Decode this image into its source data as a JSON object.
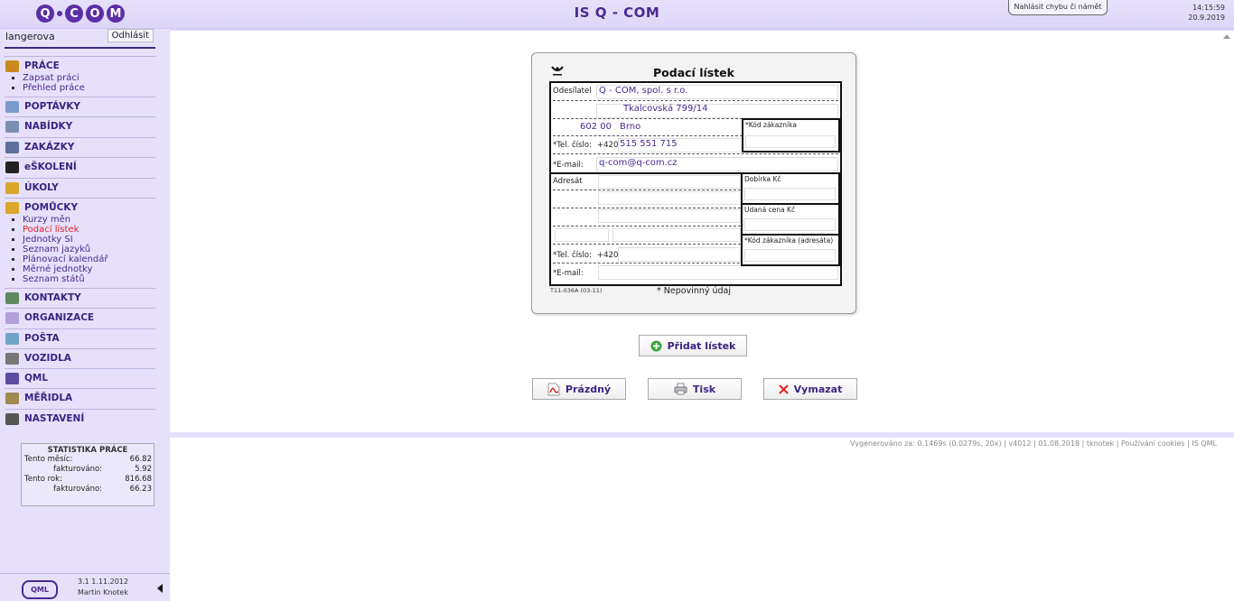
{
  "header": {
    "logo_letters": [
      "Q",
      "C",
      "O",
      "M"
    ],
    "title": "IS Q - COM",
    "bug_button": "Nahlásit chybu či námět",
    "time": "14:15:59",
    "date": "20.9.2019"
  },
  "user": {
    "name": "langerova",
    "logout_label": "Odhlásit"
  },
  "nav": [
    {
      "key": "prace",
      "label": "PRÁCE",
      "icon": "briefcase-icon",
      "color": "#c98a1f",
      "subitems": [
        {
          "label": "Zapsat práci",
          "active": false
        },
        {
          "label": "Přehled práce",
          "active": false
        }
      ]
    },
    {
      "key": "poptavky",
      "label": "POPTÁVKY",
      "icon": "bulb-icon",
      "color": "#7a9acb",
      "subitems": []
    },
    {
      "key": "nabidky",
      "label": "NABÍDKY",
      "icon": "document-icon",
      "color": "#7a8fb0",
      "subitems": []
    },
    {
      "key": "zakazky",
      "label": "ZAKÁZKY",
      "icon": "toolbox-icon",
      "color": "#5a6f9a",
      "subitems": []
    },
    {
      "key": "eskoleni",
      "label": "eŠKOLENÍ",
      "icon": "graduation-cap-icon",
      "color": "#222222",
      "subitems": []
    },
    {
      "key": "ukoly",
      "label": "ÚKOLY",
      "icon": "checklist-icon",
      "color": "#d9a72a",
      "subitems": []
    },
    {
      "key": "pomucky",
      "label": "POMŮCKY",
      "icon": "coins-icon",
      "color": "#d9a72a",
      "subitems": [
        {
          "label": "Kurzy měn",
          "active": false
        },
        {
          "label": "Podací lístek",
          "active": true
        },
        {
          "label": "Jednotky SI",
          "active": false
        },
        {
          "label": "Seznam jazyků",
          "active": false
        },
        {
          "label": "Plánovací kalendář",
          "active": false
        },
        {
          "label": "Měrné jednotky",
          "active": false
        },
        {
          "label": "Seznam států",
          "active": false
        }
      ]
    },
    {
      "key": "kontakty",
      "label": "KONTAKTY",
      "icon": "contacts-icon",
      "color": "#5f8a5f",
      "subitems": []
    },
    {
      "key": "organizace",
      "label": "ORGANIZACE",
      "icon": "cube-icon",
      "color": "#b3a0d8",
      "subitems": []
    },
    {
      "key": "posta",
      "label": "POŠTA",
      "icon": "mail-icon",
      "color": "#6fa3c8",
      "subitems": []
    },
    {
      "key": "vozidla",
      "label": "VOZIDLA",
      "icon": "car-icon",
      "color": "#777777",
      "subitems": []
    },
    {
      "key": "qml",
      "label": "QML",
      "icon": "qml-icon",
      "color": "#5a4aa0",
      "subitems": []
    },
    {
      "key": "meridla",
      "label": "MĚŘIDLA",
      "icon": "ruler-icon",
      "color": "#a08a50",
      "subitems": []
    },
    {
      "key": "nastaveni",
      "label": "NASTAVENÍ",
      "icon": "tools-icon",
      "color": "#555555",
      "subitems": []
    }
  ],
  "stats": {
    "title": "STATISTIKA PRÁCE",
    "rows": [
      {
        "label": "Tento měsíc:",
        "value": "66.82",
        "indent": false
      },
      {
        "label": "fakturováno:",
        "value": "5.92",
        "indent": true
      },
      {
        "label": "Tento rok:",
        "value": "816.68",
        "indent": false
      },
      {
        "label": "fakturováno:",
        "value": "66.23",
        "indent": true
      }
    ]
  },
  "footer_left": {
    "badge": "QML",
    "version": "3.1  1.11.2012",
    "author": "Martin Knotek"
  },
  "card": {
    "title": "Podací lístek",
    "sender_label": "Odesílatel",
    "sender_name": "Q - COM, spol. s r.o.",
    "sender_street": "Tkalcovská 799/14",
    "sender_zip": "602 00",
    "sender_city": "Brno",
    "phone_label": "*Tel. číslo:",
    "phone_prefix": "+420",
    "sender_phone": "515 551 715",
    "email_label": "*E-mail:",
    "sender_email": "q-com@q-com.cz",
    "customer_code_label": "*Kód zákazníka",
    "recipient_label": "Adresát",
    "cod_label": "Dobírka Kč",
    "value_label": "Udaná cena Kč",
    "recipient_code_label": "*Kód zákazníka (adresáta)",
    "recipient_phone_label": "*Tel. číslo:",
    "recipient_phone_prefix": "+420",
    "recipient_email_label": "*E-mail:",
    "form_code": "T11-036A (03-11)",
    "mandatory_note": "* Nepovinný údaj"
  },
  "buttons": {
    "add": "Přidat lístek",
    "empty": "Prázdný",
    "print": "Tisk",
    "delete": "Vymazat"
  },
  "footer_main": "Vygenerováno za: 0.1469s (0.0279s, 20x) | v4012 | 01.08.2018 | tknotek | Používání cookies | IS QML",
  "colors": {
    "accent": "#4b2a8e",
    "sidebar_bg": "#e6e0fb",
    "active_link": "#e0242b"
  }
}
